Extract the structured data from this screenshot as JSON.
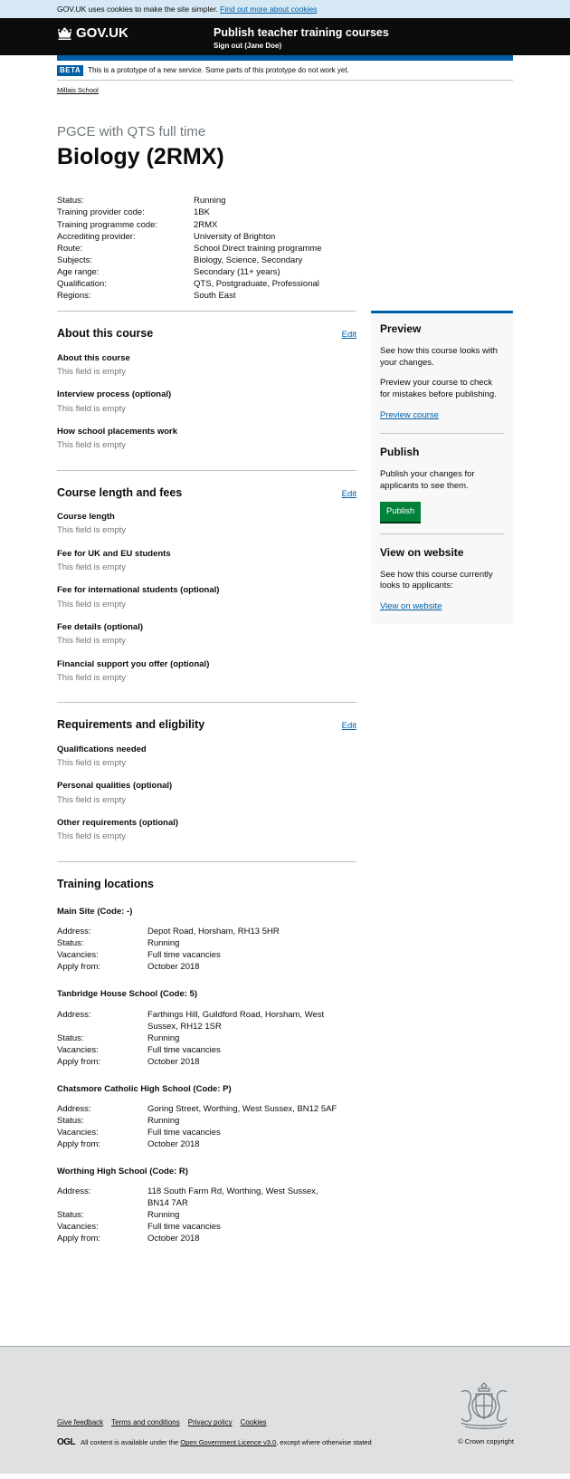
{
  "cookie": {
    "text": "GOV.UK uses cookies to make the site simpler.",
    "link": "Find out more about cookies"
  },
  "header": {
    "logo": "GOV.UK",
    "service_name": "Publish teacher training courses",
    "sign_out": "Sign out (Jane Doe)"
  },
  "phase": {
    "tag": "BETA",
    "text": "This is a prototype of a new service. Some parts of this prototype do not work yet."
  },
  "breadcrumb": "Millais School",
  "course": {
    "caption": "PGCE with QTS full time",
    "title": "Biology (2RMX)"
  },
  "summary": [
    {
      "key": "Status:",
      "value": "Running"
    },
    {
      "key": "Training provider code:",
      "value": "1BK"
    },
    {
      "key": "Training programme code:",
      "value": "2RMX"
    },
    {
      "key": "Accrediting provider:",
      "value": "University of Brighton"
    },
    {
      "key": "Route:",
      "value": "School Direct training programme"
    },
    {
      "key": "Subjects:",
      "value": "Biology, Science, Secondary"
    },
    {
      "key": "Age range:",
      "value": "Secondary (11+ years)"
    },
    {
      "key": "Qualification:",
      "value": "QTS, Postgraduate, Professional"
    },
    {
      "key": "Regions:",
      "value": "South East"
    }
  ],
  "sections": [
    {
      "title": "About this course",
      "edit": "Edit",
      "items": [
        {
          "label": "About this course",
          "value": "This field is empty"
        },
        {
          "label": "Interview process (optional)",
          "value": "This field is empty"
        },
        {
          "label": "How school placements work",
          "value": "This field is empty"
        }
      ]
    },
    {
      "title": "Course length and fees",
      "edit": "Edit",
      "items": [
        {
          "label": "Course length",
          "value": "This field is empty"
        },
        {
          "label": "Fee for UK and EU students",
          "value": "This field is empty"
        },
        {
          "label": "Fee for international students (optional)",
          "value": "This field is empty"
        },
        {
          "label": "Fee details (optional)",
          "value": "This field is empty"
        },
        {
          "label": "Financial support you offer (optional)",
          "value": "This field is empty"
        }
      ]
    },
    {
      "title": "Requirements and eligbility",
      "edit": "Edit",
      "items": [
        {
          "label": "Qualifications needed",
          "value": "This field is empty"
        },
        {
          "label": "Personal qualities (optional)",
          "value": "This field is empty"
        },
        {
          "label": "Other requirements (optional)",
          "value": "This field is empty"
        }
      ]
    }
  ],
  "locations": {
    "title": "Training locations",
    "labels": {
      "address": "Address:",
      "status": "Status:",
      "vacancies": "Vacancies:",
      "apply_from": "Apply from:"
    },
    "sites": [
      {
        "name": "Main Site (Code: -)",
        "address": "Depot Road, Horsham, RH13 5HR",
        "status": "Running",
        "vacancies": "Full time vacancies",
        "apply_from": "October 2018"
      },
      {
        "name": "Tanbridge House School (Code: 5)",
        "address": "Farthings Hill, Guildford Road, Horsham, West Sussex, RH12 1SR",
        "status": "Running",
        "vacancies": "Full time vacancies",
        "apply_from": "October 2018"
      },
      {
        "name": "Chatsmore Catholic High School (Code: P)",
        "address": "Goring Street, Worthing, West Sussex, BN12 5AF",
        "status": "Running",
        "vacancies": "Full time vacancies",
        "apply_from": "October 2018"
      },
      {
        "name": "Worthing High School (Code: R)",
        "address": "118 South Farm Rd, Worthing, West Sussex, BN14 7AR",
        "status": "Running",
        "vacancies": "Full time vacancies",
        "apply_from": "October 2018"
      }
    ]
  },
  "aside": {
    "preview": {
      "title": "Preview",
      "p1": "See how this course looks with your changes.",
      "p2": "Preview your course to check for mistakes before publishing.",
      "link": "Preview course"
    },
    "publish": {
      "title": "Publish",
      "p1": "Publish your changes for applicants to see them.",
      "button": "Publish"
    },
    "website": {
      "title": "View on website",
      "p1": "See how this course currently looks to applicants:",
      "link": "View on website"
    }
  },
  "footer": {
    "links": [
      "Give feedback",
      "Terms and conditions",
      "Privacy policy",
      "Cookies"
    ],
    "ogl": "OGL",
    "licence_pre": "All content is available under the",
    "licence_link": "Open Government Licence v3.0",
    "licence_post": ", except where otherwise stated",
    "copyright": "© Crown copyright"
  },
  "colors": {
    "brand_blue": "#005ea5",
    "button_green": "#00823b",
    "header_black": "#0b0c0c",
    "secondary_text": "#6f777b"
  }
}
